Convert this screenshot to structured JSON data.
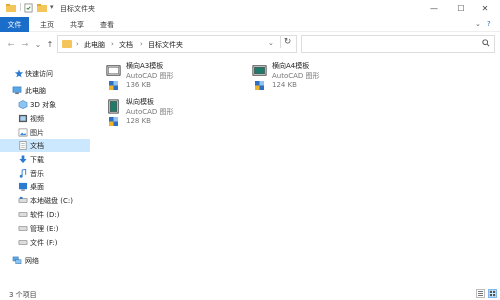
{
  "window": {
    "title": "目标文件夹",
    "minimize": "—",
    "maximize": "☐",
    "close": "✕"
  },
  "ribbon": {
    "tabs": [
      "文件",
      "主页",
      "共享",
      "查看"
    ]
  },
  "address": {
    "back": "←",
    "forward": "→",
    "recent": "⌄",
    "up": "↑",
    "breadcrumbs": [
      "此电脑",
      "文档",
      "目标文件夹"
    ],
    "separator": "›",
    "dropdown": "⌄",
    "refresh": "↻",
    "search_placeholder": "",
    "search_icon": "⌕"
  },
  "sidebar": {
    "items": [
      {
        "label": "快速访问",
        "icon": "star-icon"
      },
      {
        "label": "此电脑",
        "icon": "computer-icon"
      },
      {
        "label": "3D 对象",
        "icon": "cube-icon"
      },
      {
        "label": "视频",
        "icon": "video-icon"
      },
      {
        "label": "图片",
        "icon": "picture-icon"
      },
      {
        "label": "文档",
        "icon": "document-icon",
        "selected": true
      },
      {
        "label": "下载",
        "icon": "download-icon"
      },
      {
        "label": "音乐",
        "icon": "music-icon"
      },
      {
        "label": "桌面",
        "icon": "desktop-icon"
      },
      {
        "label": "本地磁盘 (C:)",
        "icon": "drive-icon"
      },
      {
        "label": "软件 (D:)",
        "icon": "drive-icon"
      },
      {
        "label": "管理 (E:)",
        "icon": "drive-icon"
      },
      {
        "label": "文件 (F:)",
        "icon": "drive-icon"
      },
      {
        "label": "网络",
        "icon": "network-icon"
      }
    ]
  },
  "files": [
    {
      "name": "横向A3模板",
      "type": "AutoCAD 图形",
      "size": "136 KB",
      "icon": "landscape-template-icon"
    },
    {
      "name": "横向A4模板",
      "type": "AutoCAD 图形",
      "size": "124 KB",
      "icon": "landscape-template-icon"
    },
    {
      "name": "纵向模板",
      "type": "AutoCAD 图形",
      "size": "128 KB",
      "icon": "portrait-template-icon"
    }
  ],
  "status": {
    "text": "3 个项目"
  },
  "colors": {
    "accent": "#1a6ec9",
    "selection": "#cce8ff",
    "folder": "#f3c55a"
  }
}
